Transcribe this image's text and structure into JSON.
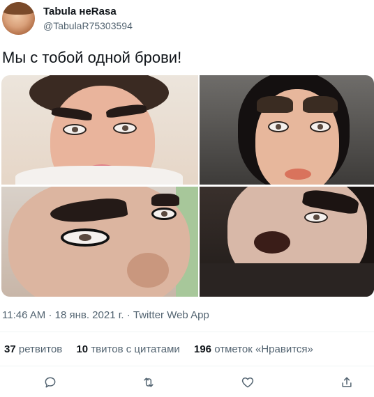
{
  "user": {
    "name": "Tabula неRasa",
    "handle": "@TabulaR75303594"
  },
  "tweet": {
    "text": "Мы с тобой одной брови!"
  },
  "meta": {
    "time": "11:46 AM",
    "sep1": "·",
    "date": "18 янв. 2021 г.",
    "sep2": "·",
    "source": "Twitter Web App"
  },
  "stats": {
    "retweets": {
      "count": "37",
      "label": "ретвитов"
    },
    "quotes": {
      "count": "10",
      "label": "твитов с цитатами"
    },
    "likes": {
      "count": "196",
      "label": "отметок «Нравится»"
    }
  },
  "actions": [
    "reply-icon",
    "retweet-icon",
    "like-icon",
    "share-icon"
  ],
  "colors": {
    "text": "#0f1419",
    "secondary": "#536471",
    "divider": "#eff3f4"
  }
}
